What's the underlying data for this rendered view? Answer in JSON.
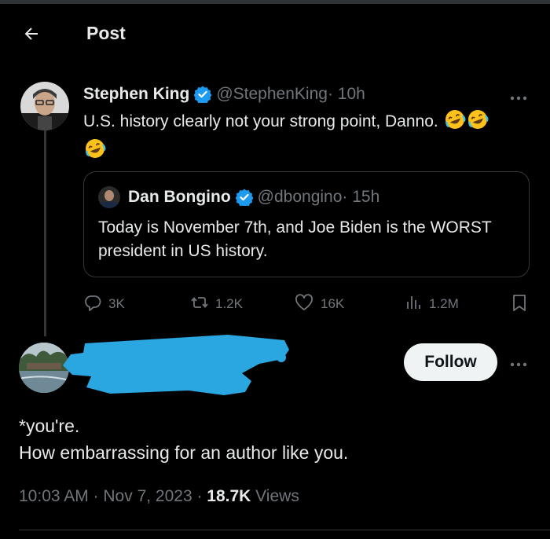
{
  "header": {
    "title": "Post",
    "back_icon": "arrow-left-icon"
  },
  "tweet": {
    "author_name": "Stephen King",
    "handle": "@StephenKing",
    "time": " · 10h",
    "text": "U.S. history clearly not your strong point, Danno.",
    "emojis": [
      "rolling-on-floor-laughing",
      "rolling-on-floor-laughing",
      "rolling-on-floor-laughing"
    ],
    "verified": true,
    "quote": {
      "author_name": "Dan Bongino",
      "handle": "@dbongino",
      "time": " · 15h",
      "text": "Today is November 7th, and Joe Biden is the WORST president in US history.",
      "verified": true
    },
    "actions": {
      "replies": "3K",
      "reposts": "1.2K",
      "likes": "16K",
      "views": "1.2M"
    }
  },
  "reply": {
    "follow_label": "Follow",
    "text_line1": "*you're.",
    "text_line2": "How embarrassing for an author like you.",
    "timestamp": "10:03 AM · Nov 7, 2023 · ",
    "views_count": "18.7K",
    "views_label": " Views"
  },
  "colors": {
    "background": "#000000",
    "text": "#e7e9ea",
    "muted": "#71767b",
    "verified": "#1d9bf0",
    "redaction": "#2aa7e0",
    "border": "#333639"
  }
}
